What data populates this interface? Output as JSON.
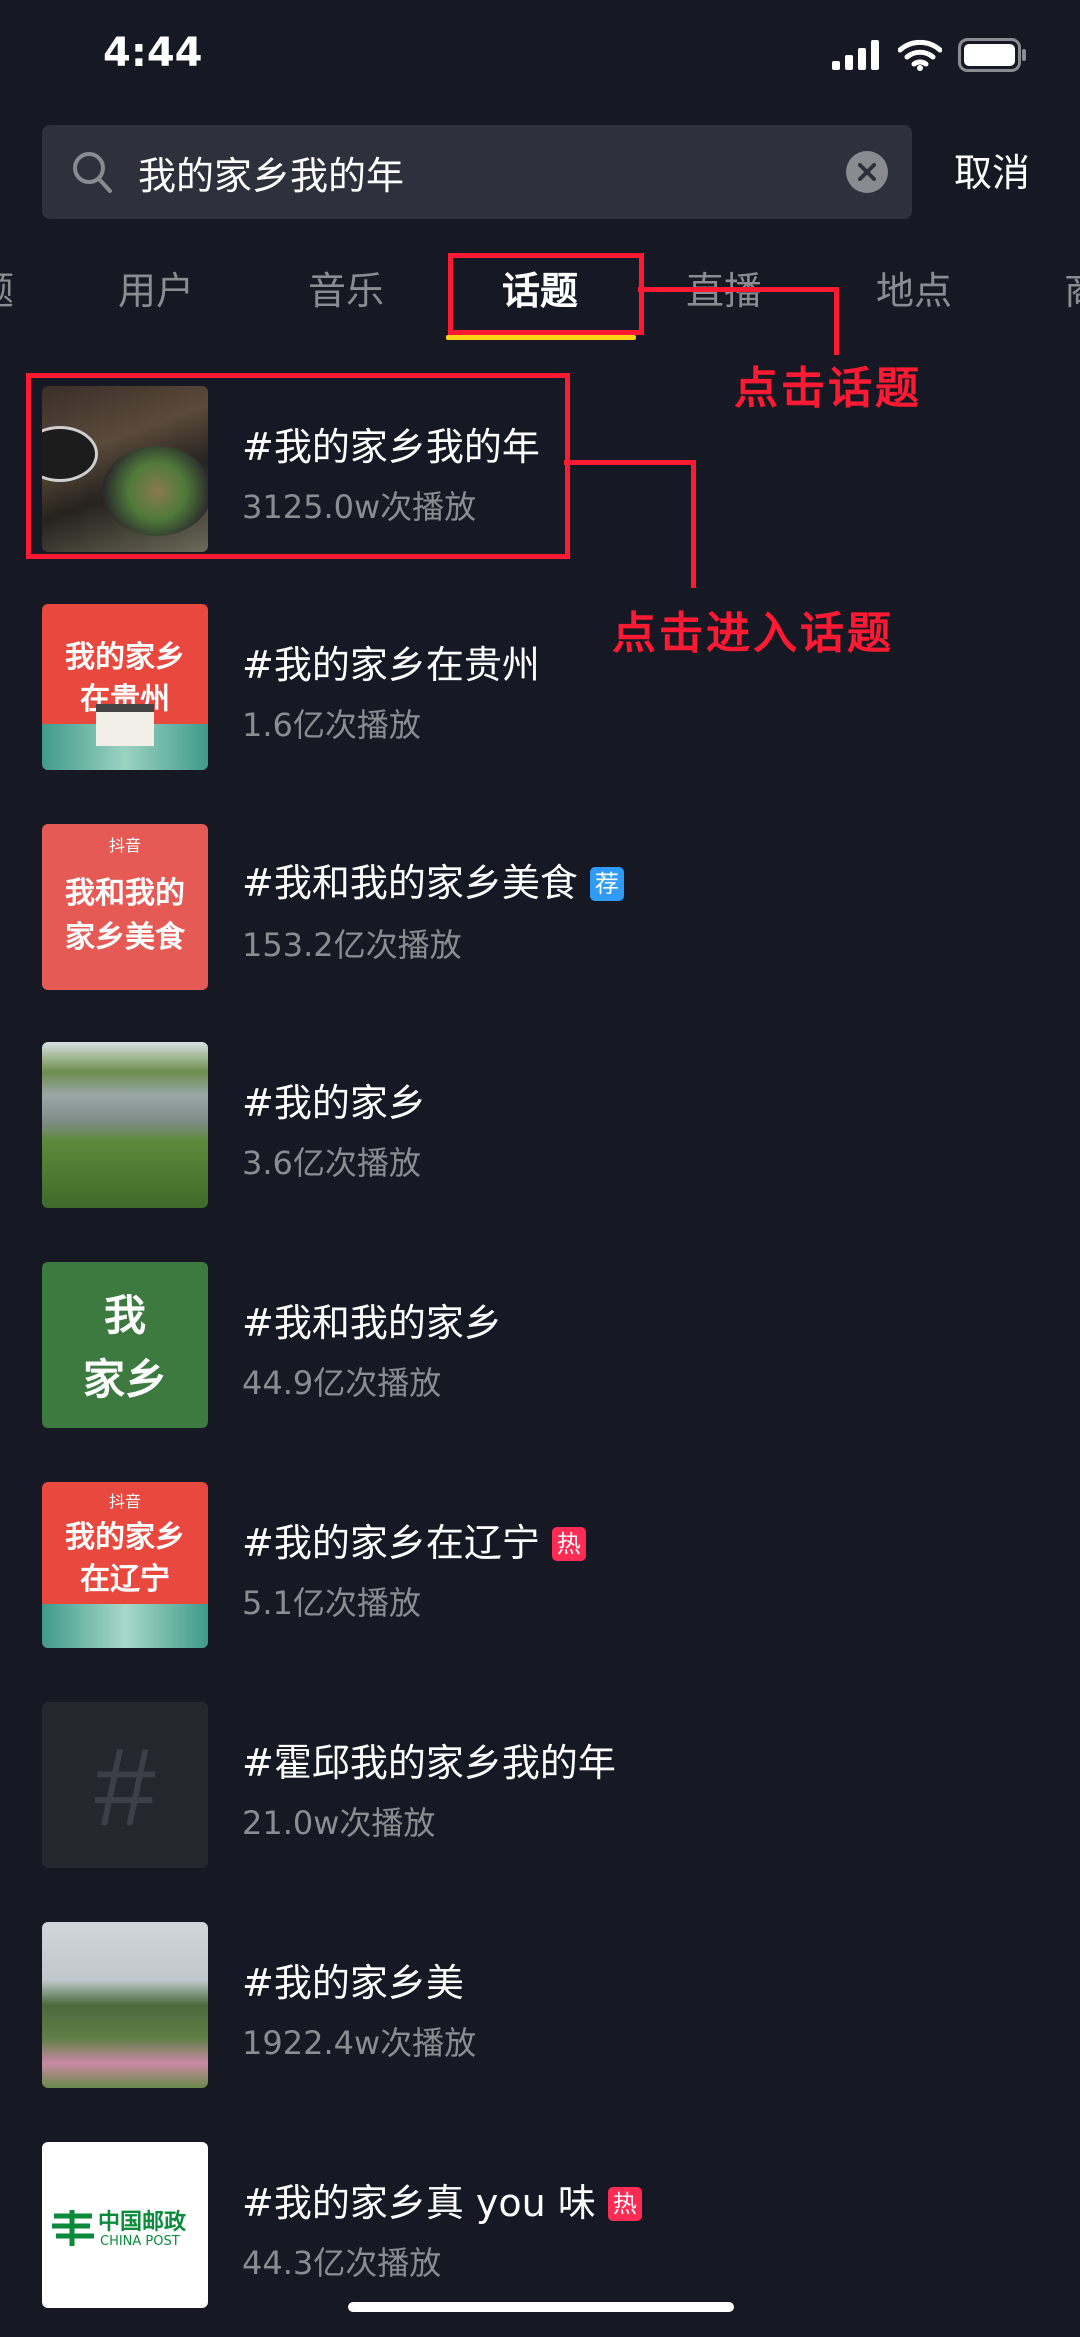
{
  "status_bar": {
    "time": "4:44"
  },
  "search": {
    "query": "我的家乡我的年",
    "cancel_label": "取消"
  },
  "tabs": [
    {
      "label": "题"
    },
    {
      "label": "用户"
    },
    {
      "label": "音乐"
    },
    {
      "label": "话题",
      "active": true
    },
    {
      "label": "直播"
    },
    {
      "label": "地点"
    },
    {
      "label": "商"
    }
  ],
  "annotations": {
    "click_topic": "点击话题",
    "click_enter_topic": "点击进入话题"
  },
  "results": [
    {
      "title": "#我的家乡我的年",
      "plays": "3125.0w次播放"
    },
    {
      "title": "#我的家乡在贵州",
      "plays": "1.6亿次播放",
      "thumb_text": [
        "我的家乡",
        "在贵州"
      ]
    },
    {
      "title": "#我和我的家乡美食",
      "plays": "153.2亿次播放",
      "badge": "荐",
      "badge_color": "#2f9bf7",
      "thumb_brand": "抖音",
      "thumb_text": [
        "我和我的",
        "家乡美食"
      ]
    },
    {
      "title": "#我的家乡",
      "plays": "3.6亿次播放"
    },
    {
      "title": "#我和我的家乡",
      "plays": "44.9亿次播放",
      "thumb_text": [
        "我",
        "家乡"
      ]
    },
    {
      "title": "#我的家乡在辽宁",
      "plays": "5.1亿次播放",
      "badge": "热",
      "badge_color": "#fe2c55",
      "thumb_brand": "抖音",
      "thumb_text": [
        "我的家乡",
        "在辽宁"
      ]
    },
    {
      "title": "#霍邱我的家乡我的年",
      "plays": "21.0w次播放",
      "thumb_symbol": "#"
    },
    {
      "title": "#我的家乡美",
      "plays": "1922.4w次播放"
    },
    {
      "title": "#我的家乡真 you 味",
      "plays": "44.3亿次播放",
      "badge": "热",
      "badge_color": "#fe2c55",
      "thumb_text": [
        "中国邮政",
        "CHINA POST"
      ]
    }
  ]
}
